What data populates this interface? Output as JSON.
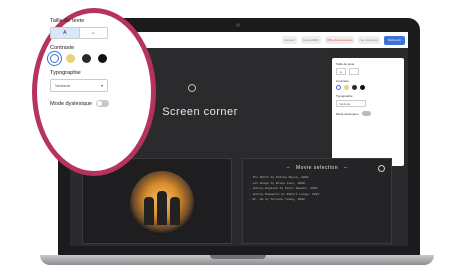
{
  "topbar": {
    "items": [
      "Contact",
      "Accessibility",
      "Offre de lancement",
      "Se connecter"
    ],
    "cta": "Découvrir"
  },
  "hero": {
    "title": "Screen  corner"
  },
  "panel_small": {
    "size_label": "Taille de texte",
    "size_a": "A",
    "contrast_label": "Contraste",
    "typography_label": "Typographie",
    "font_value": "Verdana",
    "dyslexic_label": "Mode dyslexique"
  },
  "movies": {
    "heading": "Movie  selection",
    "lines": [
      "- The  Ninth  by  Philip  Noyce,  2002",
      "- Lit  Amiga  by  Bruce  Leon,  2006",
      "- Johnny  English  by  Peter  Howitt,  2003",
      "- Johnny  Mnemonic  by  Robert  Longo,  2021",
      "- Dr.  No  by  Terence  Young,  1962"
    ]
  },
  "zoom_panel": {
    "size_label": "Taille de texte",
    "size_options": [
      "A",
      "A"
    ],
    "contrast_label": "Contraste",
    "contrast_colors": [
      "#ffffff",
      "#e8d27a",
      "#2a2a2a",
      "#111111"
    ],
    "typography_label": "Typographie",
    "font_value": "Verdana",
    "dyslexic_label": "Mode dyslexique"
  }
}
